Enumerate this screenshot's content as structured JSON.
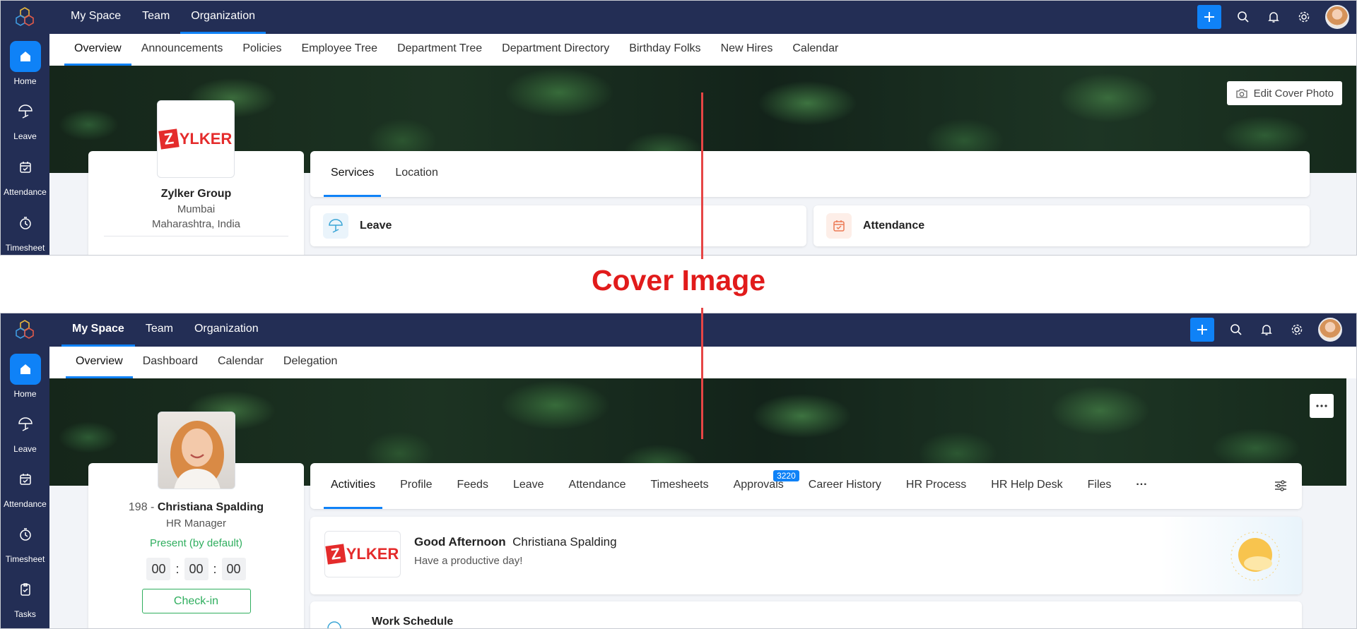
{
  "caption": "Cover Image",
  "colors": {
    "accent": "#0f82f7",
    "nav_bg": "#232e55",
    "caption_red": "#e11b1b",
    "present_green": "#2fae5e"
  },
  "panel_a": {
    "sidebar": [
      {
        "label": "Home",
        "icon": "home-icon",
        "active": true
      },
      {
        "label": "Leave",
        "icon": "umbrella-icon"
      },
      {
        "label": "Attendance",
        "icon": "calendar-check-icon"
      },
      {
        "label": "Timesheet",
        "icon": "timer-icon"
      }
    ],
    "top_nav": [
      "My Space",
      "Team",
      "Organization"
    ],
    "sub_nav": [
      "Overview",
      "Announcements",
      "Policies",
      "Employee Tree",
      "Department Tree",
      "Department Directory",
      "Birthday Folks",
      "New Hires",
      "Calendar"
    ],
    "edit_cover_label": "Edit Cover Photo",
    "org": {
      "logo_text": "YLKER",
      "logo_letter": "Z",
      "name": "Zylker Group",
      "city": "Mumbai",
      "region": "Maharashtra, India"
    },
    "tabs": [
      "Services",
      "Location"
    ],
    "services": [
      {
        "label": "Leave",
        "icon": "umbrella-icon"
      },
      {
        "label": "Attendance",
        "icon": "calendar-check-icon"
      }
    ]
  },
  "panel_b": {
    "sidebar": [
      {
        "label": "Home",
        "icon": "home-icon",
        "active": true
      },
      {
        "label": "Leave",
        "icon": "umbrella-icon"
      },
      {
        "label": "Attendance",
        "icon": "calendar-check-icon"
      },
      {
        "label": "Timesheet",
        "icon": "timer-icon"
      },
      {
        "label": "Tasks",
        "icon": "clipboard-check-icon"
      }
    ],
    "top_nav": [
      "My Space",
      "Team",
      "Organization"
    ],
    "sub_nav": [
      "Overview",
      "Dashboard",
      "Calendar",
      "Delegation"
    ],
    "profile": {
      "emp_id": "198 - ",
      "name": "Christiana Spalding",
      "role": "HR Manager",
      "status": "Present (by default)",
      "timer": [
        "00",
        "00",
        "00"
      ],
      "timer_sep": ":",
      "checkin_label": "Check-in"
    },
    "tabs": [
      "Activities",
      "Profile",
      "Feeds",
      "Leave",
      "Attendance",
      "Timesheets",
      "Approvals",
      "Career History",
      "HR Process",
      "HR Help Desk",
      "Files"
    ],
    "tabs_more": "···",
    "approvals_badge": "3220",
    "greeting": {
      "title": "Good Afternoon",
      "name": "Christiana Spalding",
      "subtitle": "Have a productive day!",
      "logo_letter": "Z",
      "logo_text": "YLKER"
    },
    "work_schedule": "Work Schedule"
  }
}
